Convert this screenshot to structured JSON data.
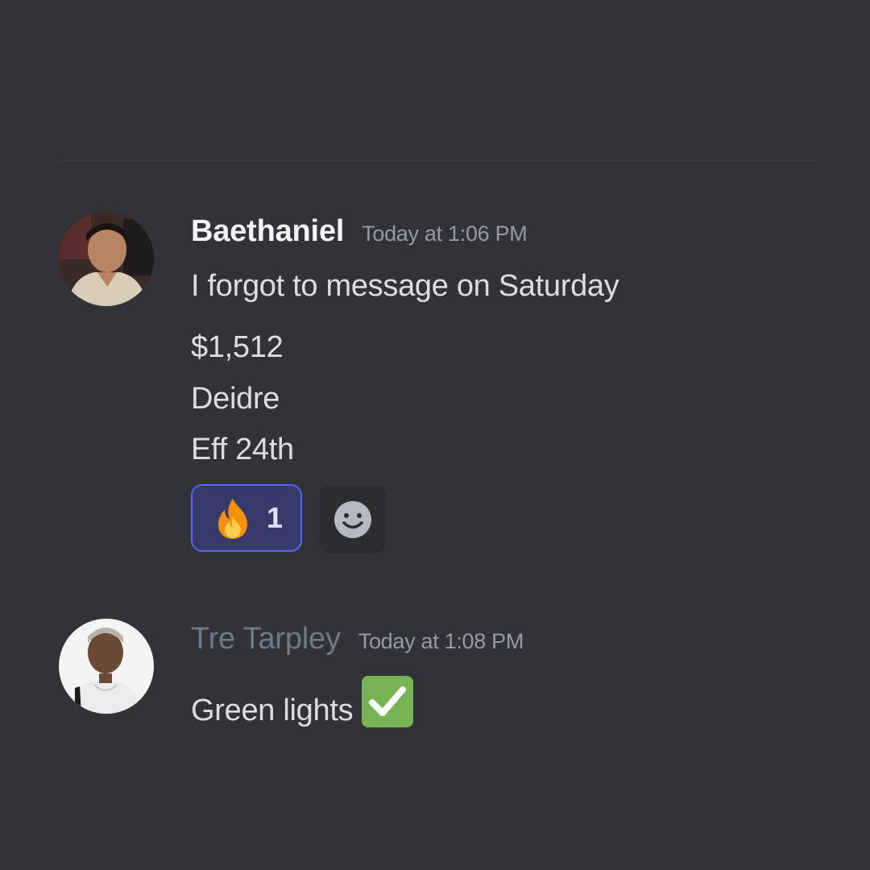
{
  "messages": [
    {
      "username": "Baethaniel",
      "timestamp": "Today at 1:06 PM",
      "lines": [
        "I forgot to message on Saturday",
        "$1,512",
        "Deidre",
        "Eff 24th"
      ],
      "reactions": [
        {
          "emoji": "fire-emoji",
          "count": "1",
          "active": true
        }
      ]
    },
    {
      "username": "Tre Tarpley",
      "timestamp": "Today at 1:08 PM",
      "text": "Green lights",
      "trailing_emoji": "white-check-mark-emoji"
    }
  ],
  "colors": {
    "background": "#313338",
    "username": "#f2f3f5",
    "username_muted": "#6d7a87",
    "timestamp": "#949ba4",
    "message_text": "#dbdee1",
    "reaction_border": "#5865f2",
    "reaction_bg": "#373a6b",
    "check_green": "#77b255"
  }
}
